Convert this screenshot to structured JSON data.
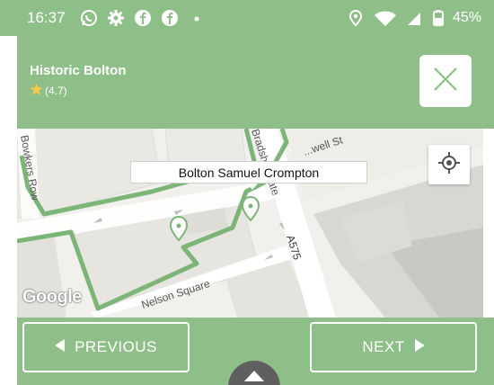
{
  "status_bar": {
    "time": "16:37",
    "battery": "45%",
    "icons": [
      "whatsapp-icon",
      "settings-gear-icon",
      "facebook-icon",
      "facebook-icon",
      "notification-dot-icon",
      "location-pin-icon",
      "wifi-icon",
      "signal-icon",
      "battery-icon"
    ]
  },
  "header": {
    "title": "Historic Bolton",
    "rating": "(4.7)",
    "close_icon": "close-x-icon"
  },
  "map": {
    "callout_label": "Bolton Samuel Crompton",
    "streets": {
      "bowkers_row": "Bowkers Row",
      "bradshawgate": "Bradshawgate",
      "street_st": "...well St",
      "a575": "A575",
      "nelson_square": "Nelson Square"
    },
    "attribution": "Google"
  },
  "navigation": {
    "previous_label": "PREVIOUS",
    "next_label": "NEXT"
  },
  "colors": {
    "theme_green": "#8fbf89",
    "route_green": "#7db578",
    "white": "#ffffff"
  }
}
